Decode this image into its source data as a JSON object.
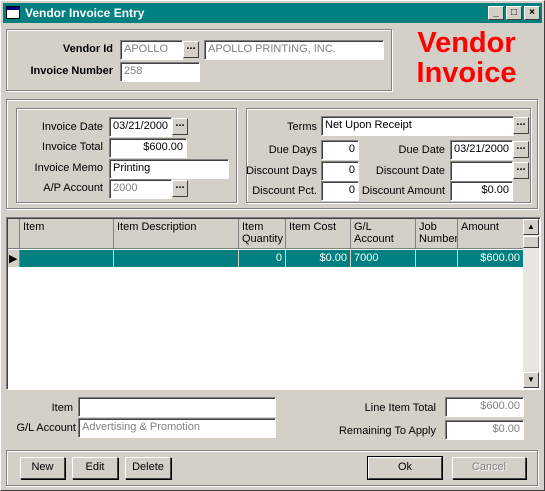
{
  "window": {
    "title": "Vendor Invoice Entry"
  },
  "header": {
    "vendor_id_label": "Vendor Id",
    "vendor_id_value": "APOLLO",
    "vendor_name": "APOLLO PRINTING, INC.",
    "invoice_number_label": "Invoice Number",
    "invoice_number_value": "258",
    "title_line1": "Vendor",
    "title_line2": "Invoice",
    "title_color": "#ff0000"
  },
  "invoice": {
    "date_label": "Invoice Date",
    "date_value": "03/21/2000",
    "total_label": "Invoice Total",
    "total_value": "$600.00",
    "memo_label": "Invoice Memo",
    "memo_value": "Printing",
    "ap_account_label": "A/P Account",
    "ap_account_value": "2000"
  },
  "terms": {
    "terms_label": "Terms",
    "terms_value": "Net Upon Receipt",
    "due_days_label": "Due Days",
    "due_days_value": "0",
    "due_date_label": "Due Date",
    "due_date_value": "03/21/2000",
    "discount_days_label": "Discount Days",
    "discount_days_value": "0",
    "discount_date_label": "Discount Date",
    "discount_date_value": "",
    "discount_pct_label": "Discount Pct.",
    "discount_pct_value": "0",
    "discount_amount_label": "Discount Amount",
    "discount_amount_value": "$0.00"
  },
  "grid": {
    "columns": [
      "Item",
      "Item Description",
      "Item Quantity",
      "Item Cost",
      "G/L Account",
      "Job Number",
      "Amount"
    ],
    "rows": [
      [
        "",
        "",
        "0",
        "$0.00",
        "7000",
        "",
        "$600.00"
      ]
    ],
    "selected_row_color": "#008080"
  },
  "detail": {
    "item_label": "Item",
    "item_value": "",
    "gl_account_label": "G/L Account",
    "gl_account_value": "Advertising & Promotion",
    "line_item_total_label": "Line Item Total",
    "line_item_total_value": "$600.00",
    "remaining_label": "Remaining To Apply",
    "remaining_value": "$0.00"
  },
  "buttons": {
    "new": "New",
    "edit": "Edit",
    "delete": "Delete",
    "ok": "Ok",
    "cancel": "Cancel"
  },
  "titlebar_controls": {
    "minimize": "_",
    "maximize": "□",
    "close": "×"
  },
  "colors": {
    "titlebar": "#008080",
    "window": "#d4d0c8"
  }
}
